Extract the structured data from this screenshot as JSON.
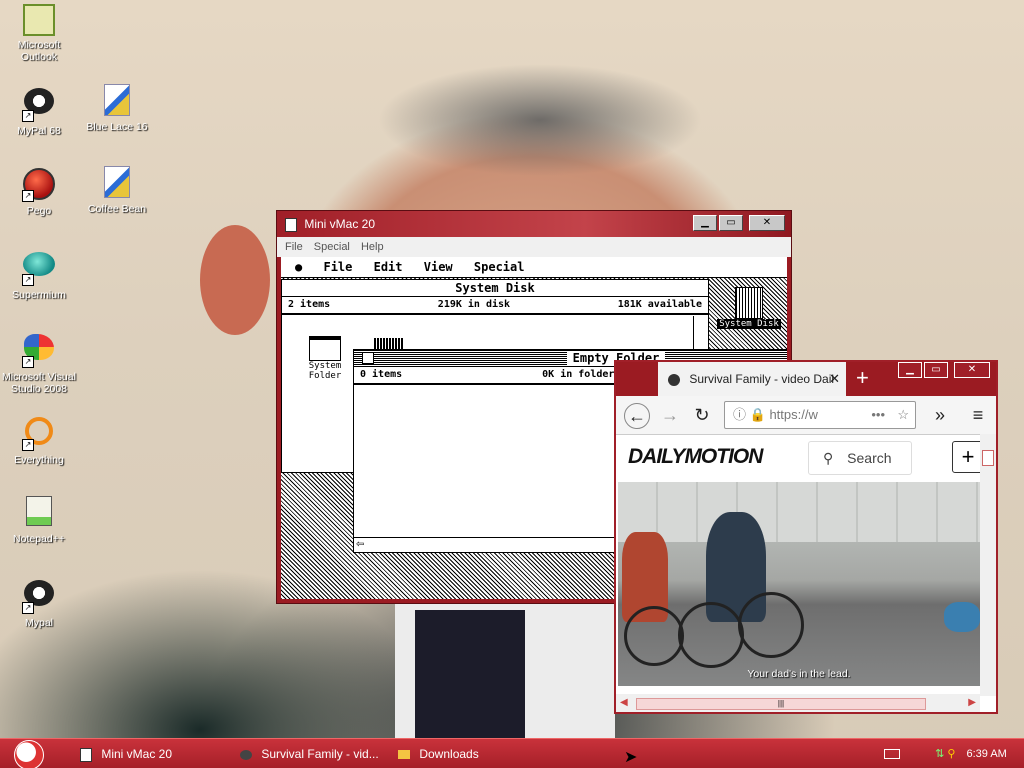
{
  "desktop": {
    "icons": [
      {
        "label": "Microsoft\nOutlook",
        "icon": "outlook-icon"
      },
      {
        "label": "MyPal 68",
        "icon": "mypal-icon"
      },
      {
        "label": "Blue Lace 16",
        "icon": "bluelace-icon"
      },
      {
        "label": "Pego",
        "icon": "pego-icon"
      },
      {
        "label": "Coffee Bean",
        "icon": "coffeebean-icon"
      },
      {
        "label": "Supermium",
        "icon": "supermium-icon"
      },
      {
        "label": "Microsoft Visual\nStudio 2008",
        "icon": "visual-studio-icon"
      },
      {
        "label": "Everything",
        "icon": "everything-icon"
      },
      {
        "label": "Notepad++",
        "icon": "notepadpp-icon"
      },
      {
        "label": "Mypal",
        "icon": "mypal-icon"
      }
    ]
  },
  "vmac": {
    "title": "Mini vMac 20",
    "menu": [
      "File",
      "Special",
      "Help"
    ],
    "mac_menu": [
      "File",
      "Edit",
      "View",
      "Special"
    ],
    "system_disk": {
      "title": "System Disk",
      "items": "2 items",
      "in_disk": "219K in disk",
      "available": "181K available",
      "folder_label": "System Folder"
    },
    "desktop_disk_label": "System Disk",
    "empty_folder": {
      "title": "Empty Folder",
      "items": "0 items",
      "in_folder": "0K in folder"
    }
  },
  "browser": {
    "tab_title": "Survival Family - video Dail",
    "url": "https://w",
    "brand": "DAILYMOTION",
    "search_label": "Search",
    "subtitle": "Your dad's in the lead."
  },
  "taskbar": {
    "items": [
      "Mini vMac 20",
      "Survival Family - vid...",
      "Downloads"
    ],
    "clock": "6:39 AM"
  },
  "colors": {
    "accent": "#a01f28",
    "taskbar": "#b8262f"
  }
}
